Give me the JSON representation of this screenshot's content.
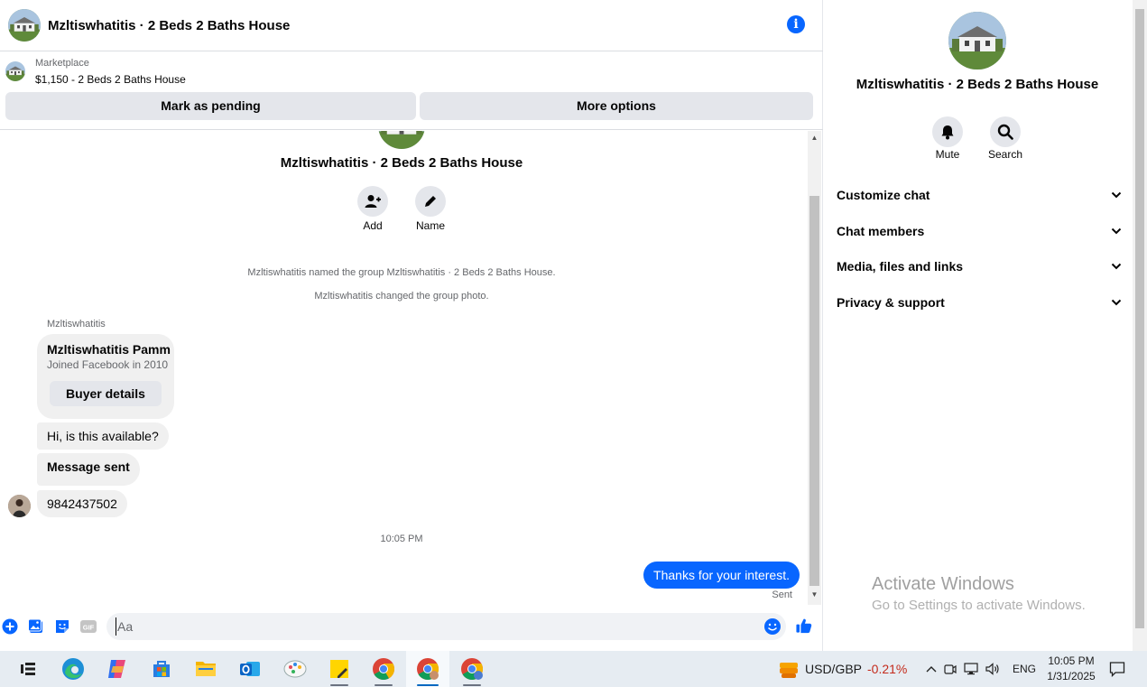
{
  "chat": {
    "title": "Mzltiswhatitis · 2 Beds 2 Baths House",
    "info_icon": "info-icon"
  },
  "marketplace": {
    "label": "Marketplace",
    "listing": "$1,150 - 2 Beds 2 Baths House",
    "mark_pending": "Mark as pending",
    "more_options": "More options"
  },
  "thread": {
    "group_name": "Mzltiswhatitis · 2 Beds 2 Baths House",
    "add_label": "Add",
    "name_label": "Name",
    "system_messages": [
      "Mzltiswhatitis named the group Mzltiswhatitis · 2 Beds 2 Baths House.",
      "Mzltiswhatitis changed the group photo."
    ],
    "sender": "Mzltiswhatitis",
    "card": {
      "name": "Mzltiswhatitis Pamm",
      "joined": "Joined Facebook in 2010",
      "button": "Buyer details"
    },
    "messages": [
      "Hi, is this available?",
      "Message sent",
      "9842437502"
    ],
    "timestamp": "10:05 PM",
    "my_message": "Thanks for your interest.",
    "my_status": "Sent"
  },
  "composer": {
    "placeholder": "Aa",
    "icons": [
      "plus-icon",
      "photo-icon",
      "sticker-icon",
      "gif-icon",
      "emoji-icon",
      "thumbs-up-icon"
    ],
    "gif_text": "GIF"
  },
  "info_panel": {
    "title": "Mzltiswhatitis · 2 Beds 2 Baths House",
    "mute_label": "Mute",
    "search_label": "Search",
    "sections": [
      "Customize chat",
      "Chat members",
      "Media, files and links",
      "Privacy & support"
    ]
  },
  "watermark": {
    "line1": "Activate Windows",
    "line2": "Go to Settings to activate Windows."
  },
  "taskbar": {
    "apps": [
      "task-view-icon",
      "edge-icon",
      "copilot-icon",
      "store-icon",
      "file-explorer-icon",
      "outlook-icon",
      "paint-icon",
      "sticky-notes-icon",
      "chrome-icon",
      "chrome-profile-icon",
      "chrome-profile2-icon"
    ],
    "stock_pair": "USD/GBP",
    "stock_change": "-0.21%",
    "language": "ENG",
    "time": "10:05 PM",
    "date": "1/31/2025"
  },
  "colors": {
    "accent": "#0866ff",
    "bubble_grey": "#f0f0f0",
    "button_grey": "#e4e6eb",
    "negative": "#c42b1c"
  }
}
